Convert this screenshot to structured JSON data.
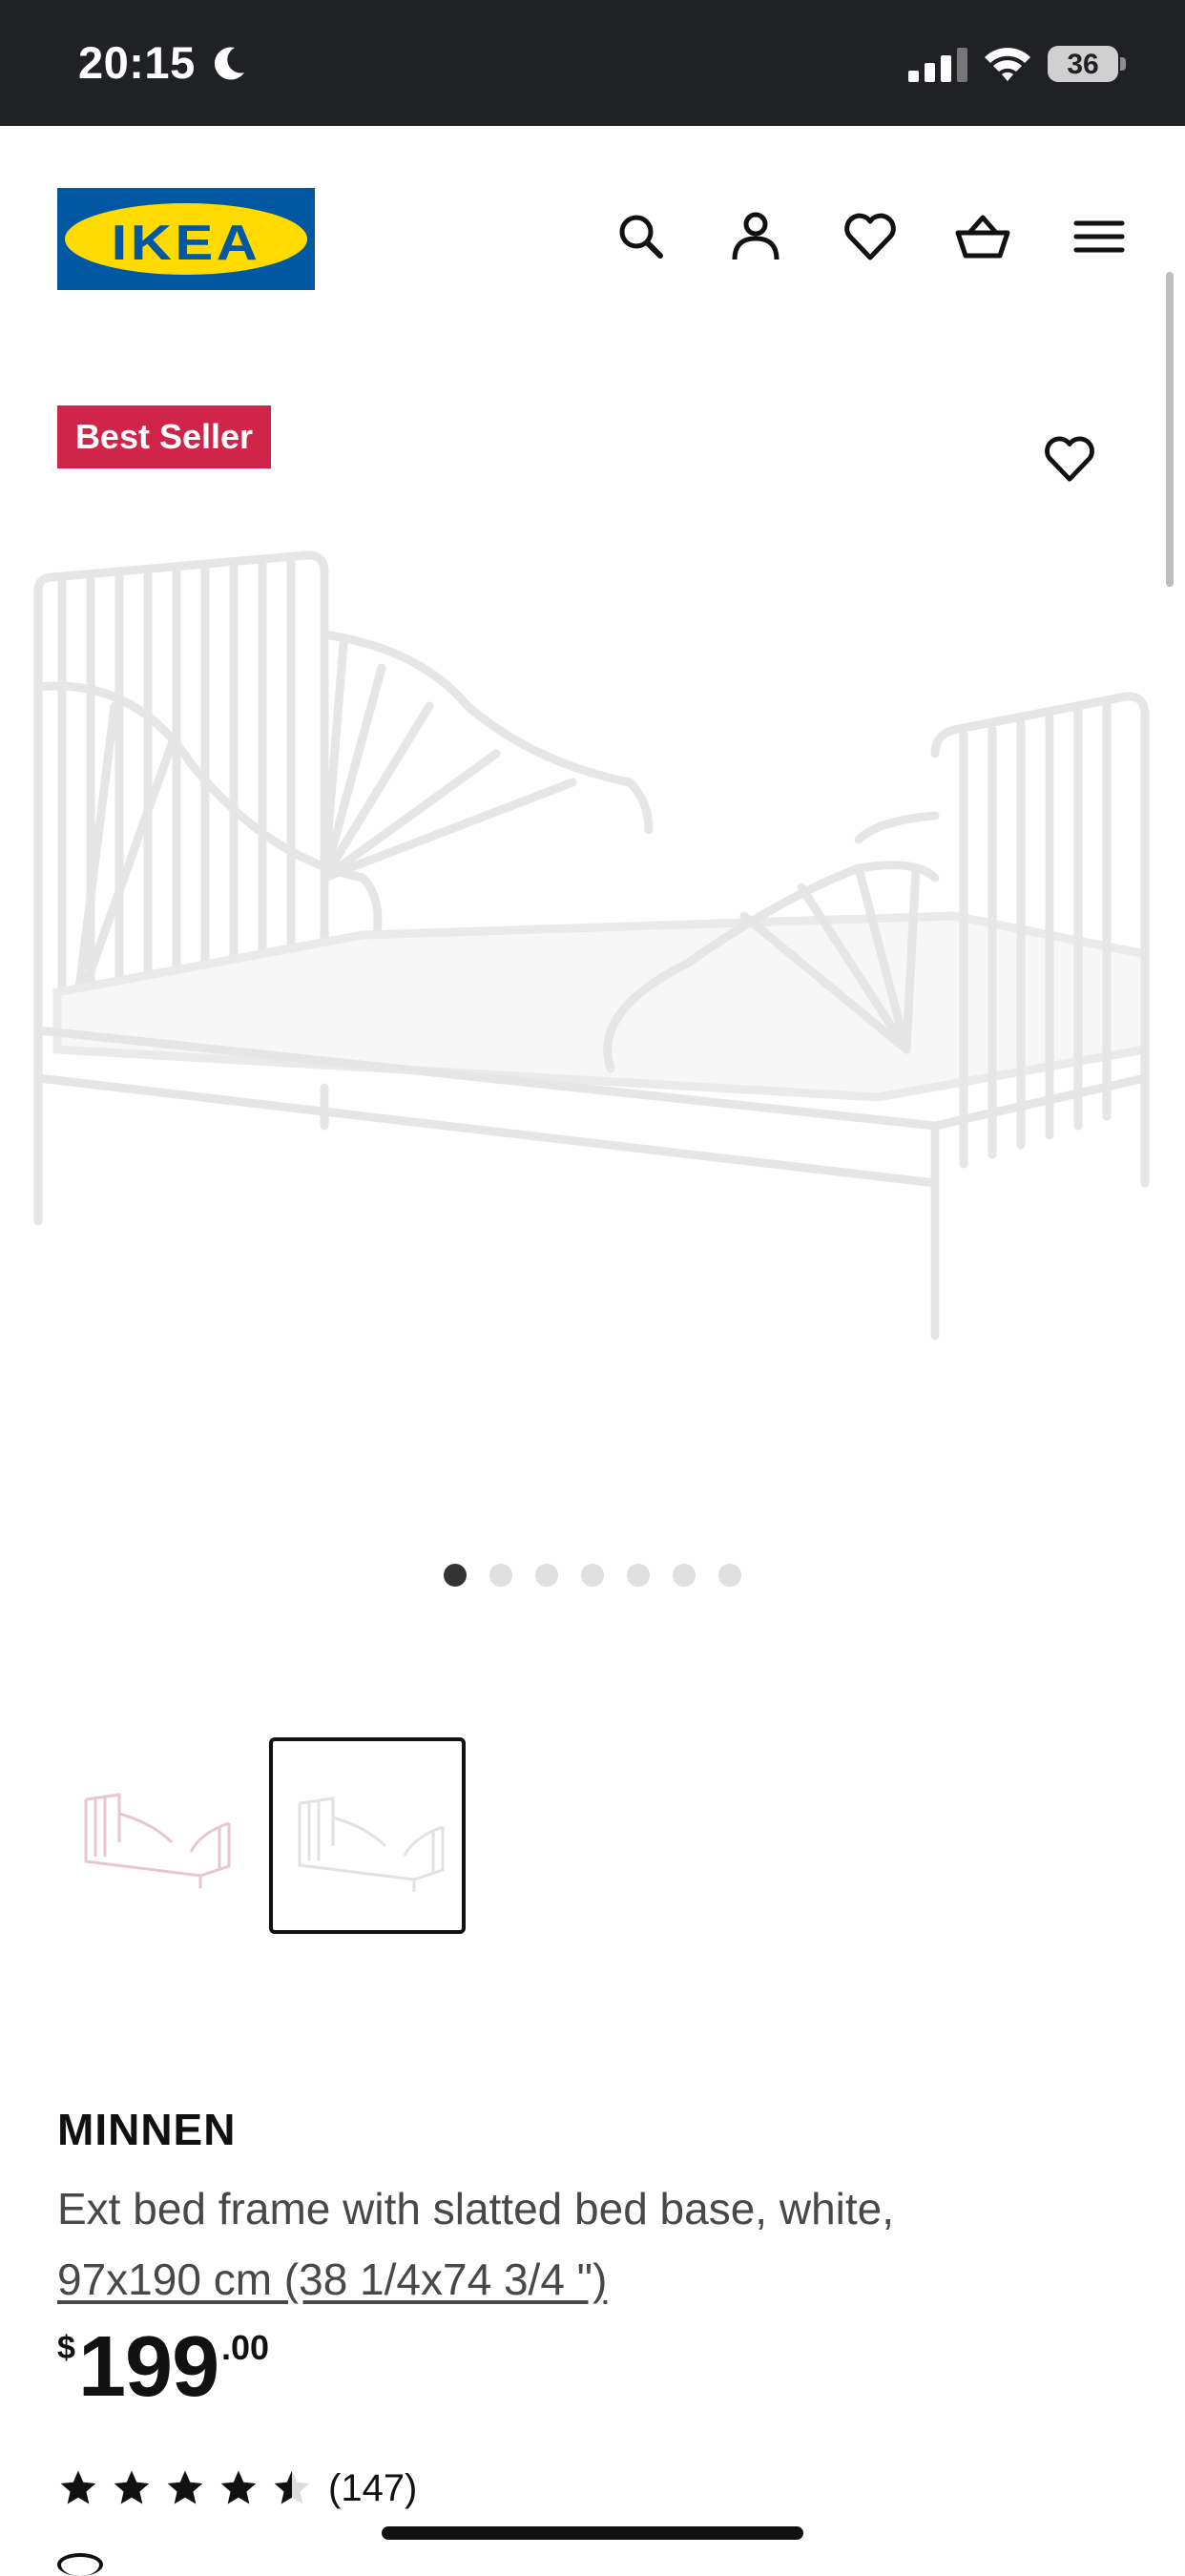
{
  "status_bar": {
    "time": "20:15",
    "battery": "36",
    "icons": [
      "moon-icon",
      "signal-icon",
      "wifi-icon",
      "battery-icon"
    ]
  },
  "header": {
    "logo_text": "IKEA",
    "icons": [
      "search-icon",
      "account-icon",
      "heart-icon",
      "basket-icon",
      "menu-icon"
    ]
  },
  "hero": {
    "badge": "Best Seller",
    "favorite_icon": "heart-icon",
    "image": "white-extendable-bed-frame",
    "dot_count": 7,
    "active_dot": 1
  },
  "thumbnails": [
    {
      "name": "pink-bed-thumbnail",
      "selected": false
    },
    {
      "name": "white-bed-thumbnail",
      "selected": true
    }
  ],
  "product": {
    "name": "MINNEN",
    "description": "Ext bed frame with slatted bed base, white,",
    "size": "97x190 cm (38 1/4x74 3/4 \")",
    "price_currency": "$",
    "price_integer": "199",
    "price_decimal": ".00",
    "rating": 4.5,
    "rating_max": 5,
    "review_count": "(147)"
  },
  "colors": {
    "status_bar_bg": "#202124",
    "ikea_blue": "#0058a3",
    "ikea_yellow": "#ffdb00",
    "badge_red": "#d0244a"
  }
}
